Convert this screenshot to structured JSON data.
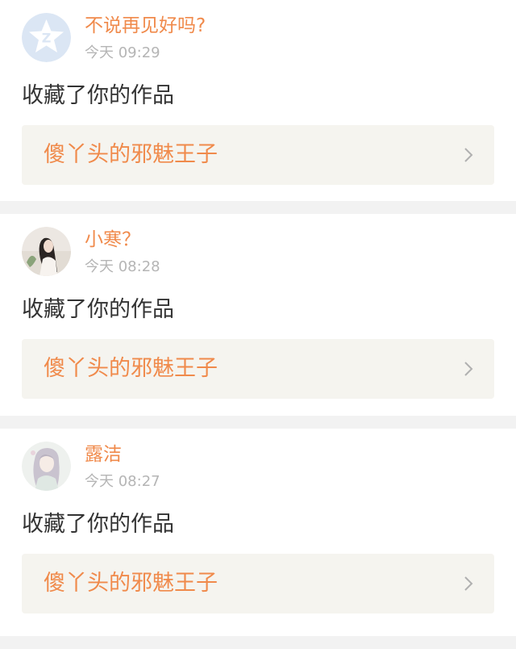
{
  "feed": {
    "items": [
      {
        "username": "不说再见好吗?",
        "time": "今天 09:29",
        "action": "收藏了你的作品",
        "work_title": "傻丫头的邪魅王子",
        "avatar_icon": "qzone-star-icon"
      },
      {
        "username": "小寒？",
        "time": "今天 08:28",
        "action": "收藏了你的作品",
        "work_title": "傻丫头的邪魅王子",
        "avatar_icon": "user-photo"
      },
      {
        "username": "露洁",
        "time": "今天 08:27",
        "action": "收藏了你的作品",
        "work_title": "傻丫头的邪魅王子",
        "avatar_icon": "user-illustration"
      }
    ],
    "colors": {
      "accent": "#f08a4b",
      "text": "#333333",
      "muted": "#b5b5b5",
      "link_bg": "#f5f4ef",
      "divider": "#f2f2f2"
    }
  }
}
